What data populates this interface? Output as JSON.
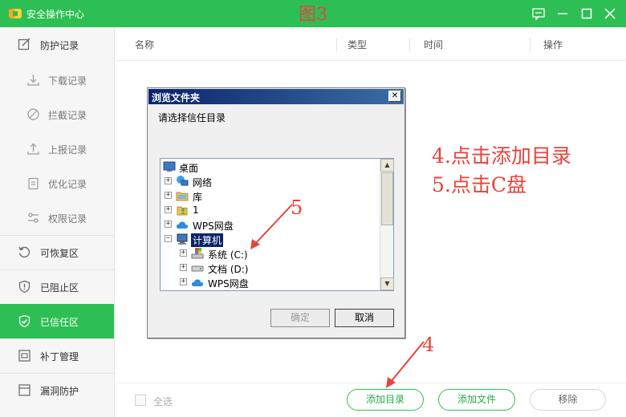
{
  "titlebar": {
    "app_title": "安全操作中心",
    "figure_label": "图3"
  },
  "sidebar": {
    "items": [
      {
        "label": "防护记录",
        "icon": "edit-icon"
      },
      {
        "label": "下载记录",
        "icon": "download-icon"
      },
      {
        "label": "拦截记录",
        "icon": "block-icon"
      },
      {
        "label": "上报记录",
        "icon": "upload-icon"
      },
      {
        "label": "优化记录",
        "icon": "clipboard-icon"
      },
      {
        "label": "权限记录",
        "icon": "sliders-icon"
      },
      {
        "label": "可恢复区",
        "icon": "restore-icon"
      },
      {
        "label": "已阻止区",
        "icon": "shield-alert-icon"
      },
      {
        "label": "已信任区",
        "icon": "shield-check-icon"
      },
      {
        "label": "补丁管理",
        "icon": "patch-icon"
      },
      {
        "label": "漏洞防护",
        "icon": "window-icon"
      }
    ],
    "active_label": "已信任区"
  },
  "table": {
    "columns": [
      "名称",
      "类型",
      "时间",
      "操作"
    ]
  },
  "bottom": {
    "select_all": "全选",
    "add_dir": "添加目录",
    "add_file": "添加文件",
    "remove": "移除"
  },
  "dialog": {
    "title": "浏览文件夹",
    "close_glyph": "✕",
    "prompt": "请选择信任目录",
    "tree": [
      {
        "label": "桌面",
        "icon": "desktop-icon",
        "expander": ""
      },
      {
        "label": "网络",
        "icon": "network-icon",
        "expander": "+"
      },
      {
        "label": "库",
        "icon": "library-icon",
        "expander": "+"
      },
      {
        "label": "1",
        "icon": "user-folder-icon",
        "expander": "+"
      },
      {
        "label": "WPS网盘",
        "icon": "cloud-icon",
        "expander": "+"
      },
      {
        "label": "计算机",
        "icon": "computer-icon",
        "expander": "−",
        "selected": true
      },
      {
        "label": "系统 (C:)",
        "icon": "system-drive-icon",
        "expander": "+"
      },
      {
        "label": "文档 (D:)",
        "icon": "drive-icon",
        "expander": "+"
      },
      {
        "label": "WPS网盘",
        "icon": "cloud-icon",
        "expander": "+"
      }
    ],
    "ok": "确定",
    "cancel": "取消"
  },
  "annotations": {
    "step4_text": "4.点击添加目录",
    "step5_text": "5.点击C盘",
    "marker5": "5",
    "marker4": "4"
  },
  "colors": {
    "brand_green": "#2dbf53",
    "annotation_red": "#e8433b",
    "dialog_title_blue": "#0a246a",
    "selection_blue": "#0a246a"
  }
}
